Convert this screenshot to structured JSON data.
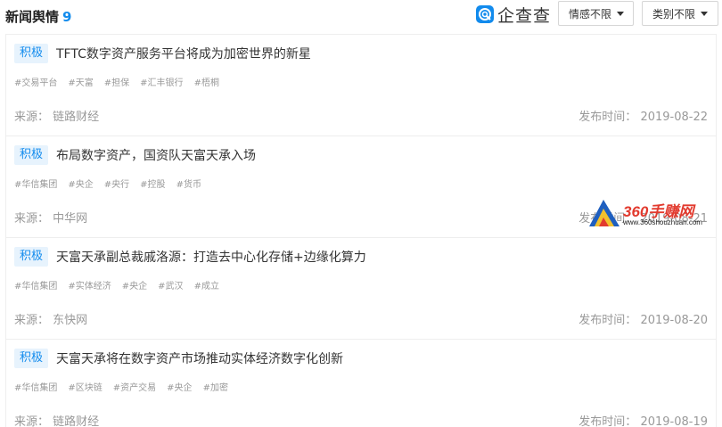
{
  "header": {
    "title": "新闻舆情",
    "count": "9",
    "brand": "企查查",
    "sentiment_filter": "情感不限",
    "category_filter": "类别不限"
  },
  "labels": {
    "source_prefix": "来源：",
    "date_prefix": "发布时间："
  },
  "items": [
    {
      "badge": "积极",
      "headline": "TFTC数字资产服务平台将成为加密世界的新星",
      "tags": [
        "#交易平台",
        "#天富",
        "#担保",
        "#汇丰银行",
        "#梧桐"
      ],
      "source": "链路财经",
      "date": "2019-08-22"
    },
    {
      "badge": "积极",
      "headline": "布局数字资产，国资队天富天承入场",
      "tags": [
        "#华信集团",
        "#央企",
        "#央行",
        "#控股",
        "#货币"
      ],
      "source": "中华网",
      "date": "2019-08-21"
    },
    {
      "badge": "积极",
      "headline": "天富天承副总裁戚洛源：打造去中心化存储+边缘化算力",
      "tags": [
        "#华信集团",
        "#实体经济",
        "#央企",
        "#武汉",
        "#成立"
      ],
      "source": "东快网",
      "date": "2019-08-20"
    },
    {
      "badge": "积极",
      "headline": "天富天承将在数字资产市场推动实体经济数字化创新",
      "tags": [
        "#华信集团",
        "#区块链",
        "#资产交易",
        "#央企",
        "#加密"
      ],
      "source": "链路财经",
      "date": "2019-08-19"
    }
  ],
  "watermark": {
    "text": "360手赚网",
    "url": "www.360shouzhuan.com"
  },
  "colors": {
    "accent": "#128bed",
    "badge_bg": "#e7f3fd",
    "muted": "#999999",
    "watermark_red": "#e23a2e"
  }
}
